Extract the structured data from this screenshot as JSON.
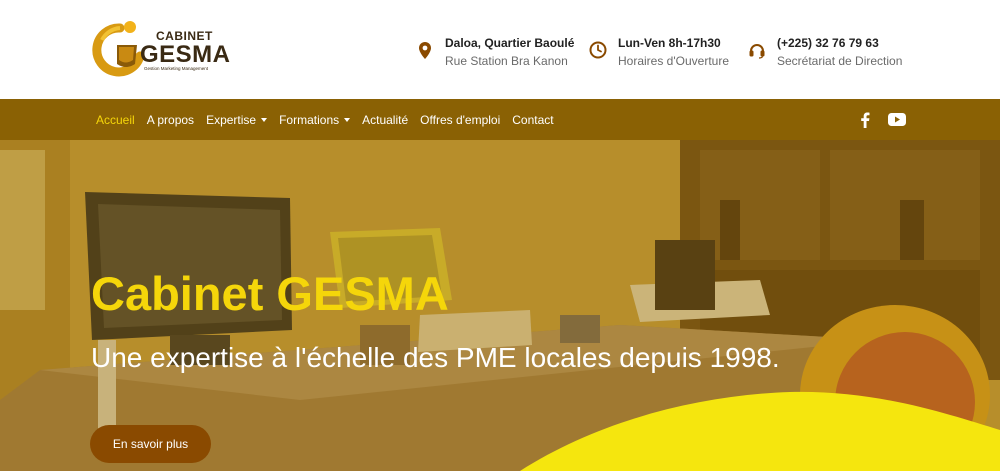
{
  "brand": {
    "line1": "CABINET",
    "line2": "GESMA",
    "tagline": "Gestion Marketing Management"
  },
  "contact": {
    "address": {
      "title": "Daloa, Quartier Baoulé",
      "subtitle": "Rue Station Bra Kanon",
      "icon": "map-pin-icon"
    },
    "hours": {
      "title": "Lun-Ven 8h-17h30",
      "subtitle": "Horaires d'Ouverture",
      "icon": "clock-icon"
    },
    "phone": {
      "title": "(+225) 32 76 79 63",
      "subtitle": "Secrétariat de Direction",
      "icon": "headset-icon"
    }
  },
  "nav": {
    "items": [
      {
        "label": "Accueil",
        "active": true,
        "dropdown": false
      },
      {
        "label": "A propos",
        "active": false,
        "dropdown": false
      },
      {
        "label": "Expertise",
        "active": false,
        "dropdown": true
      },
      {
        "label": "Formations",
        "active": false,
        "dropdown": true
      },
      {
        "label": "Actualité",
        "active": false,
        "dropdown": false
      },
      {
        "label": "Offres d'emploi",
        "active": false,
        "dropdown": false
      },
      {
        "label": "Contact",
        "active": false,
        "dropdown": false
      }
    ],
    "socials": [
      "facebook-icon",
      "youtube-icon"
    ]
  },
  "hero": {
    "title": "Cabinet GESMA",
    "subtitle": "Une expertise à l'échelle des PME locales depuis 1998.",
    "cta": "En savoir plus"
  },
  "colors": {
    "nav_bg": "#8a6104",
    "accent_yellow": "#f5d60a",
    "icon_brown": "#8a4a00",
    "button_bg": "#8a4a00"
  }
}
